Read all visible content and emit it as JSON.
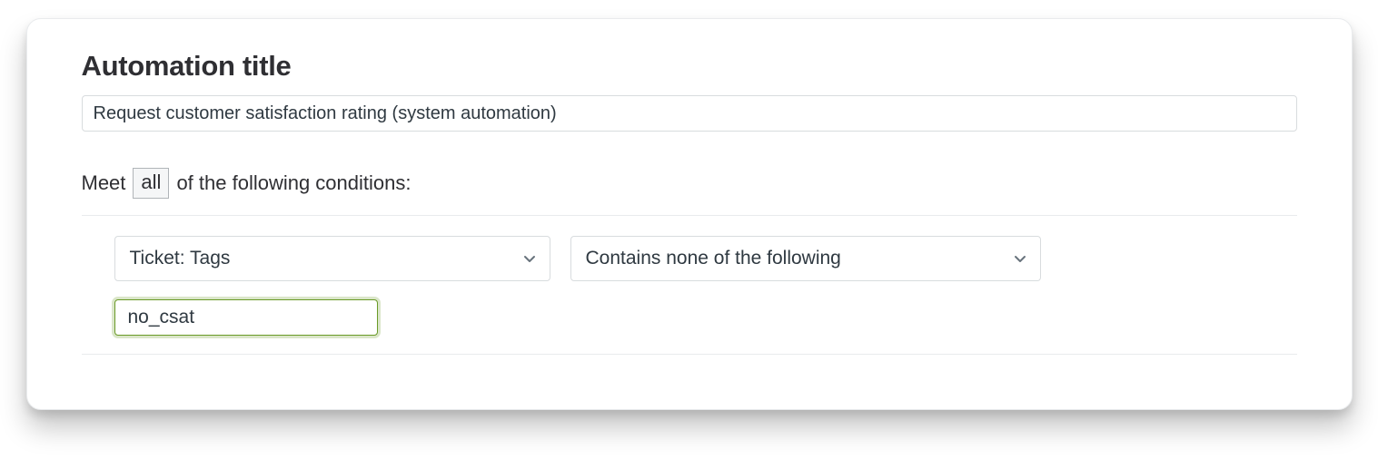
{
  "heading": "Automation title",
  "title_value": "Request customer satisfaction rating (system automation)",
  "conditions": {
    "meet_text_before": "Meet",
    "meet_selector": "all",
    "meet_text_after": "of the following conditions:",
    "row": {
      "field": "Ticket: Tags",
      "operator": "Contains none of the following",
      "tag_value": "no_csat"
    }
  }
}
